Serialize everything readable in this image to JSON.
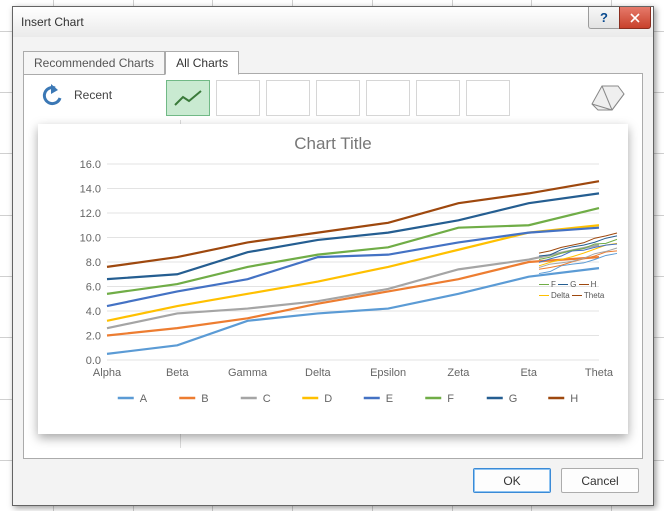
{
  "dialog": {
    "title": "Insert Chart",
    "tabs": {
      "recommended": "Recommended Charts",
      "all": "All Charts"
    },
    "active_tab": "all",
    "back_label": "Recent",
    "ok": "OK",
    "cancel": "Cancel"
  },
  "chart_data": {
    "type": "line",
    "title": "Chart Title",
    "xlabel": "",
    "ylabel": "",
    "ylim": [
      0,
      16
    ],
    "ystep": 2,
    "categories": [
      "Alpha",
      "Beta",
      "Gamma",
      "Delta",
      "Epsilon",
      "Zeta",
      "Eta",
      "Theta"
    ],
    "series": [
      {
        "name": "A",
        "color": "#5b9bd5",
        "values": [
          0.5,
          1.2,
          3.2,
          3.8,
          4.2,
          5.4,
          6.8,
          7.5
        ]
      },
      {
        "name": "B",
        "color": "#ed7d31",
        "values": [
          2.0,
          2.6,
          3.4,
          4.6,
          5.6,
          6.6,
          8.0,
          8.4
        ]
      },
      {
        "name": "C",
        "color": "#a5a5a5",
        "values": [
          2.6,
          3.8,
          4.2,
          4.8,
          5.8,
          7.4,
          8.2,
          9.4
        ]
      },
      {
        "name": "D",
        "color": "#ffc000",
        "values": [
          3.2,
          4.4,
          5.4,
          6.4,
          7.6,
          9.0,
          10.4,
          11.0
        ]
      },
      {
        "name": "E",
        "color": "#4472c4",
        "values": [
          4.4,
          5.6,
          6.6,
          8.4,
          8.6,
          9.6,
          10.4,
          10.8
        ]
      },
      {
        "name": "F",
        "color": "#70ad47",
        "values": [
          5.4,
          6.2,
          7.6,
          8.6,
          9.2,
          10.8,
          11.0,
          12.4
        ]
      },
      {
        "name": "G",
        "color": "#255e91",
        "values": [
          6.6,
          7.0,
          8.8,
          9.8,
          10.4,
          11.4,
          12.8,
          13.6
        ]
      },
      {
        "name": "H",
        "color": "#9e480e",
        "values": [
          7.6,
          8.4,
          9.6,
          10.4,
          11.2,
          12.8,
          13.6,
          14.6
        ]
      }
    ],
    "legend_position": "bottom"
  },
  "mini": {
    "legend_labels": [
      "F",
      "G",
      "H",
      "Delta",
      "Theta"
    ]
  },
  "colors": {
    "accent": "#4f8bd0"
  }
}
